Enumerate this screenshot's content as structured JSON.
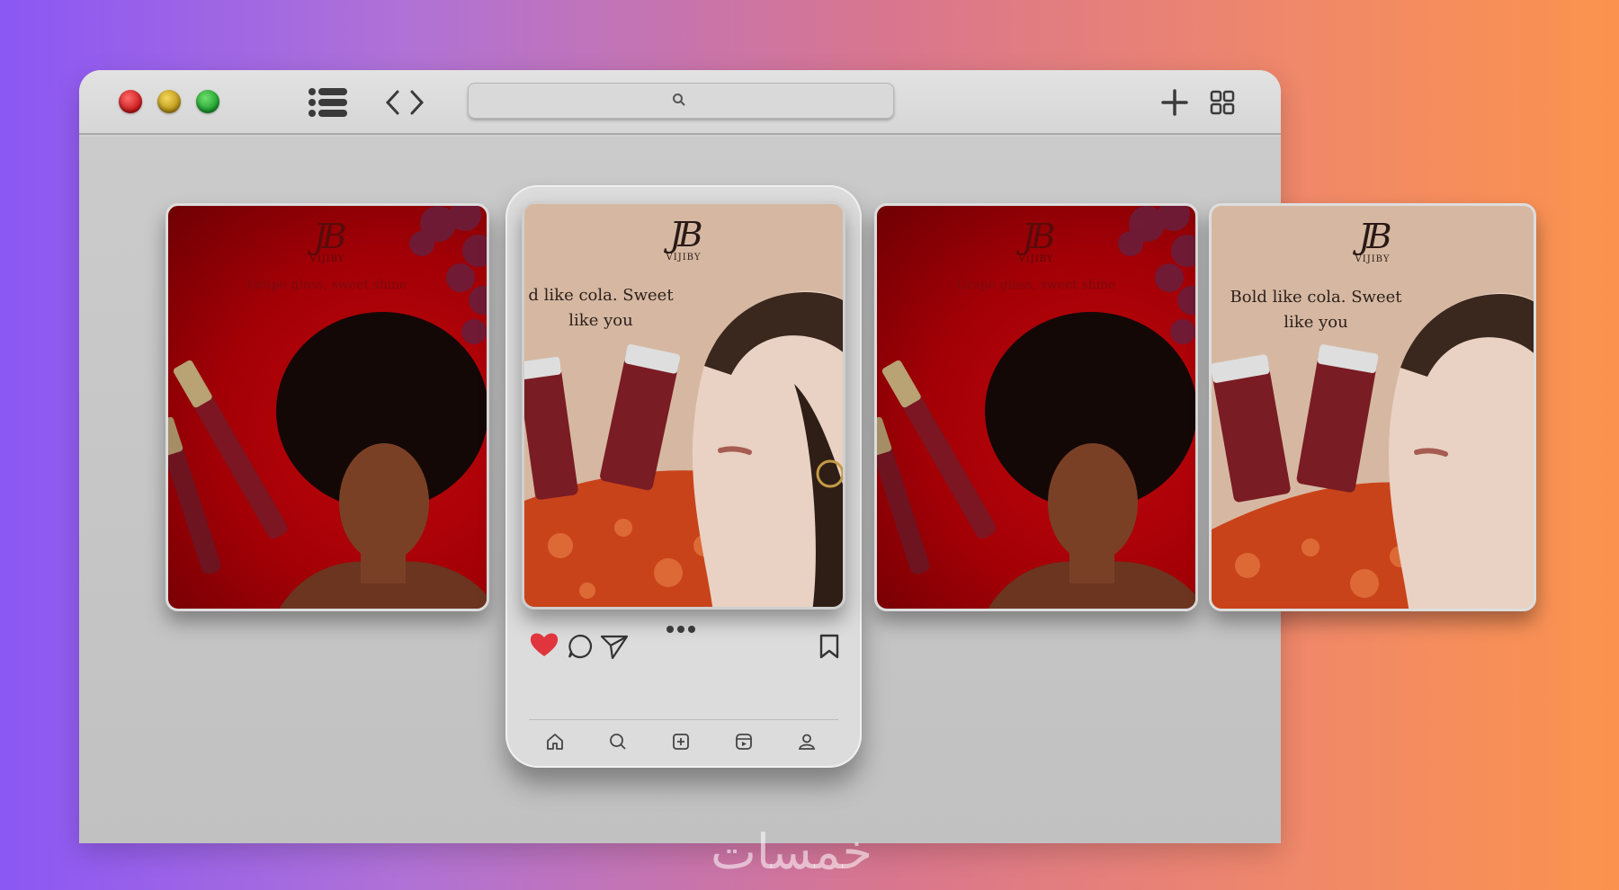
{
  "window": {
    "traffic_lights": [
      "close",
      "minimize",
      "zoom"
    ],
    "address_bar": {
      "value": "",
      "icon": "search-icon"
    },
    "toolbar_icons": [
      "list-icon",
      "code-icon",
      "plus-icon",
      "grid-icon"
    ]
  },
  "posts": [
    {
      "style": "red",
      "logo_mark": "JB",
      "brand": "VIJIBY",
      "tagline": "Grape gloss, sweet shine"
    },
    {
      "style": "beige",
      "logo_mark": "JB",
      "brand": "VIJIBY",
      "tagline": "Bold like cola. Sweet like you"
    },
    {
      "style": "red",
      "logo_mark": "JB",
      "brand": "VIJIBY",
      "tagline": "Grape gloss, sweet shine"
    },
    {
      "style": "beige",
      "logo_mark": "JB",
      "brand": "VIJIBY",
      "tagline": "Bold like cola. Sweet like you"
    }
  ],
  "phone": {
    "featured_tagline": "d like cola. Sweet like you",
    "actions": [
      "heart-icon",
      "comment-icon",
      "share-icon",
      "bookmark-icon"
    ],
    "nav": [
      "home-icon",
      "search-icon",
      "create-icon",
      "reels-icon",
      "profile-icon"
    ],
    "colors": {
      "like": "#e0353d"
    }
  },
  "watermark": "خمسات"
}
